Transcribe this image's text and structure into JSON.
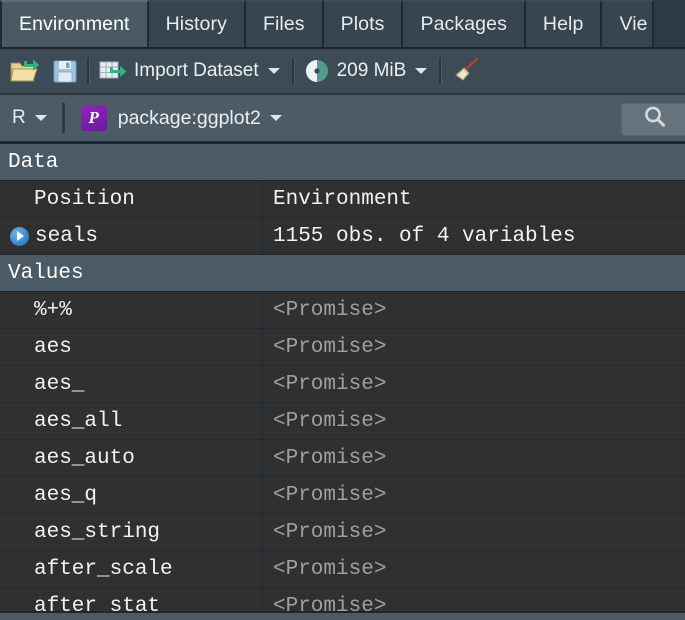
{
  "tabs": [
    {
      "label": "Environment",
      "active": true
    },
    {
      "label": "History",
      "active": false
    },
    {
      "label": "Files",
      "active": false
    },
    {
      "label": "Plots",
      "active": false
    },
    {
      "label": "Packages",
      "active": false
    },
    {
      "label": "Help",
      "active": false
    },
    {
      "label": "Vie",
      "active": false
    }
  ],
  "toolbar": {
    "open_icon": "open-folder-icon",
    "save_icon": "save-disk-icon",
    "import_icon": "import-dataset-grid-icon",
    "import_label": "Import Dataset",
    "memory_icon": "memory-pie-icon",
    "memory_label": "209 MiB",
    "broom_icon": "broom-icon"
  },
  "envbar": {
    "language_label": "R",
    "package_badge": "P",
    "package_label": "package:ggplot2",
    "search_icon": "search-icon",
    "search_value": "",
    "search_placeholder": ""
  },
  "colors": {
    "tab_active": "#4a5a65",
    "tab_inactive": "#36454f",
    "toolbar_bg": "#3c4b55",
    "envbar_bg": "#4c5b66",
    "grid_bg": "#2b2b2b",
    "section_head_bg": "#4b5a65",
    "row_bg": "#303030",
    "promise_text": "#9aa0a4",
    "annotation": "#fe0000",
    "package_badge": "#7b1fa2",
    "expand_arrow": "#3d8fd1"
  },
  "sections": [
    {
      "title": "Data",
      "rows": [
        {
          "name": "Position",
          "value": "Environment",
          "expandable": false,
          "promise": false
        },
        {
          "name": "seals",
          "value": "1155 obs. of 4 variables",
          "expandable": true,
          "promise": false
        }
      ]
    },
    {
      "title": "Values",
      "rows": [
        {
          "name": "%+%",
          "value": "<Promise>",
          "expandable": false,
          "promise": true
        },
        {
          "name": "aes",
          "value": "<Promise>",
          "expandable": false,
          "promise": true
        },
        {
          "name": "aes_",
          "value": "<Promise>",
          "expandable": false,
          "promise": true
        },
        {
          "name": "aes_all",
          "value": "<Promise>",
          "expandable": false,
          "promise": true
        },
        {
          "name": "aes_auto",
          "value": "<Promise>",
          "expandable": false,
          "promise": true
        },
        {
          "name": "aes_q",
          "value": "<Promise>",
          "expandable": false,
          "promise": true
        },
        {
          "name": "aes_string",
          "value": "<Promise>",
          "expandable": false,
          "promise": true
        },
        {
          "name": "after_scale",
          "value": "<Promise>",
          "expandable": false,
          "promise": true
        },
        {
          "name": "after_stat",
          "value": "<Promise>",
          "expandable": false,
          "promise": true
        }
      ]
    }
  ]
}
